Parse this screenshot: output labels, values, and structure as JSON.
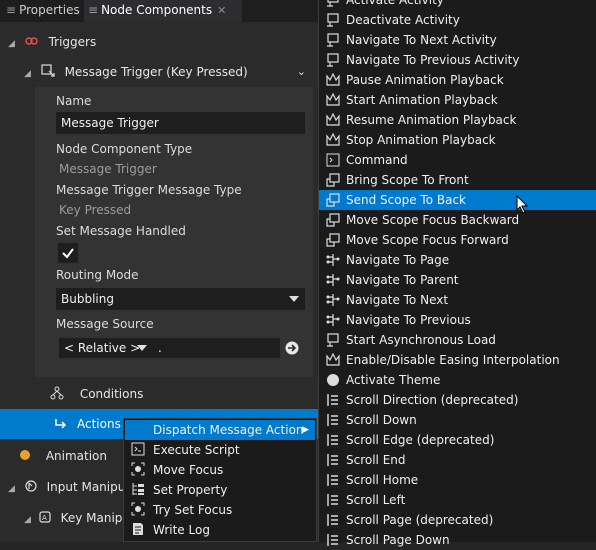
{
  "tabs": [
    {
      "label": "Properties"
    },
    {
      "label": "Node Components",
      "close": "✕"
    }
  ],
  "tree": {
    "triggers": "Triggers",
    "message_trigger": "Message Trigger (Key Pressed)",
    "conditions": "Conditions",
    "actions": "Actions",
    "animation": "Animation",
    "input_manipulation": "Input Manipula",
    "key_manipulation": "Key Manipu"
  },
  "props": {
    "name_label": "Name",
    "name_value": "Message Trigger",
    "nct_label": "Node Component Type",
    "nct_value": "Message Trigger",
    "mtmt_label": "Message Trigger Message Type",
    "mtmt_value": "Key Pressed",
    "smh_label": "Set Message Handled",
    "smh_checked": true,
    "routing_label": "Routing Mode",
    "routing_value": "Bubbling",
    "source_label": "Message Source",
    "source_mode": "< Relative >",
    "source_path": "."
  },
  "context_menu": [
    {
      "label": "Dispatch Message Action",
      "highlighted": true,
      "submenu": true,
      "icon": "none"
    },
    {
      "label": "Execute Script",
      "icon": "script-icon"
    },
    {
      "label": "Move Focus",
      "icon": "focus-icon"
    },
    {
      "label": "Set Property",
      "icon": "tree-icon"
    },
    {
      "label": "Try Set Focus",
      "icon": "focus-icon"
    },
    {
      "label": "Write Log",
      "icon": "log-icon"
    }
  ],
  "actions_list": [
    {
      "label": "Activate Activity",
      "icon": "message-icon"
    },
    {
      "label": "Deactivate Activity",
      "icon": "message-icon"
    },
    {
      "label": "Navigate To Next Activity",
      "icon": "message-icon"
    },
    {
      "label": "Navigate To Previous Activity",
      "icon": "message-icon"
    },
    {
      "label": "Pause Animation Playback",
      "icon": "animation-icon"
    },
    {
      "label": "Start Animation Playback",
      "icon": "animation-icon"
    },
    {
      "label": "Resume Animation Playback",
      "icon": "animation-icon"
    },
    {
      "label": "Stop Animation Playback",
      "icon": "animation-icon"
    },
    {
      "label": "Command",
      "icon": "command-icon"
    },
    {
      "label": "Bring Scope To Front",
      "icon": "scope-icon"
    },
    {
      "label": "Send Scope To Back",
      "icon": "scope-icon",
      "selected": true
    },
    {
      "label": "Move Scope Focus Backward",
      "icon": "scope-icon"
    },
    {
      "label": "Move Scope Focus Forward",
      "icon": "scope-icon"
    },
    {
      "label": "Navigate To Page",
      "icon": "navigation-icon"
    },
    {
      "label": "Navigate To Parent",
      "icon": "navigation-icon"
    },
    {
      "label": "Navigate To Next",
      "icon": "navigation-icon"
    },
    {
      "label": "Navigate To Previous",
      "icon": "navigation-icon"
    },
    {
      "label": "Start Asynchronous Load",
      "icon": "message-icon"
    },
    {
      "label": "Enable/Disable Easing Interpolation",
      "icon": "animation-icon"
    },
    {
      "label": "Activate Theme",
      "icon": "theme-icon"
    },
    {
      "label": "Scroll Direction (deprecated)",
      "icon": "scroll-icon"
    },
    {
      "label": "Scroll Down",
      "icon": "scroll-icon"
    },
    {
      "label": "Scroll Edge (deprecated)",
      "icon": "scroll-icon"
    },
    {
      "label": "Scroll End",
      "icon": "scroll-icon"
    },
    {
      "label": "Scroll Home",
      "icon": "scroll-icon"
    },
    {
      "label": "Scroll Left",
      "icon": "scroll-icon"
    },
    {
      "label": "Scroll Page (deprecated)",
      "icon": "scroll-icon"
    },
    {
      "label": "Scroll Page Down",
      "icon": "scroll-icon"
    }
  ],
  "colors": {
    "accent": "#007acc",
    "panel": "#2b2b2b",
    "menu": "#1b1b1b"
  }
}
